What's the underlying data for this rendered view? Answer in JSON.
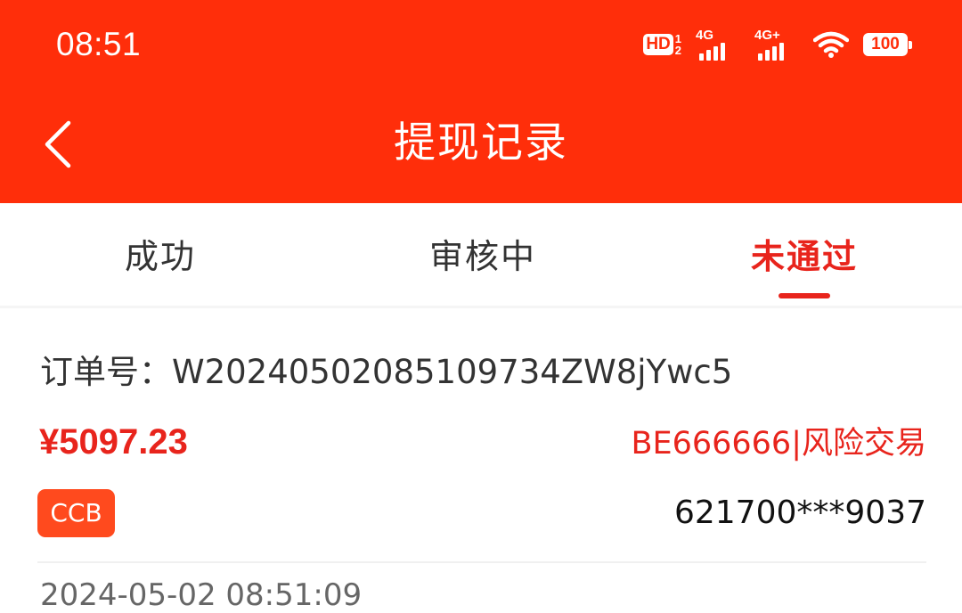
{
  "status_bar": {
    "time": "08:51",
    "hd_label": "HD",
    "hd_top": "1",
    "hd_bottom": "2",
    "signal_1": "4G",
    "signal_2": "4G+",
    "battery": "100"
  },
  "nav": {
    "title": "提现记录",
    "back_icon": "chevron-left-icon"
  },
  "tabs": [
    {
      "label": "成功",
      "active": false
    },
    {
      "label": "审核中",
      "active": false
    },
    {
      "label": "未通过",
      "active": true
    }
  ],
  "record": {
    "order_label": "订单号：",
    "order_no": "W2024050208510973​4ZW8jYwc5",
    "amount": "¥5097.23",
    "fail_reason": "BE666666|风险交易",
    "bank": "CCB",
    "card_number": "621700***9037",
    "next_date": "2024-05-02 08:51:09"
  },
  "colors": {
    "header_bg": "#ff2e0a",
    "accent": "#e8241c",
    "bank_badge": "#ff4a1e"
  }
}
